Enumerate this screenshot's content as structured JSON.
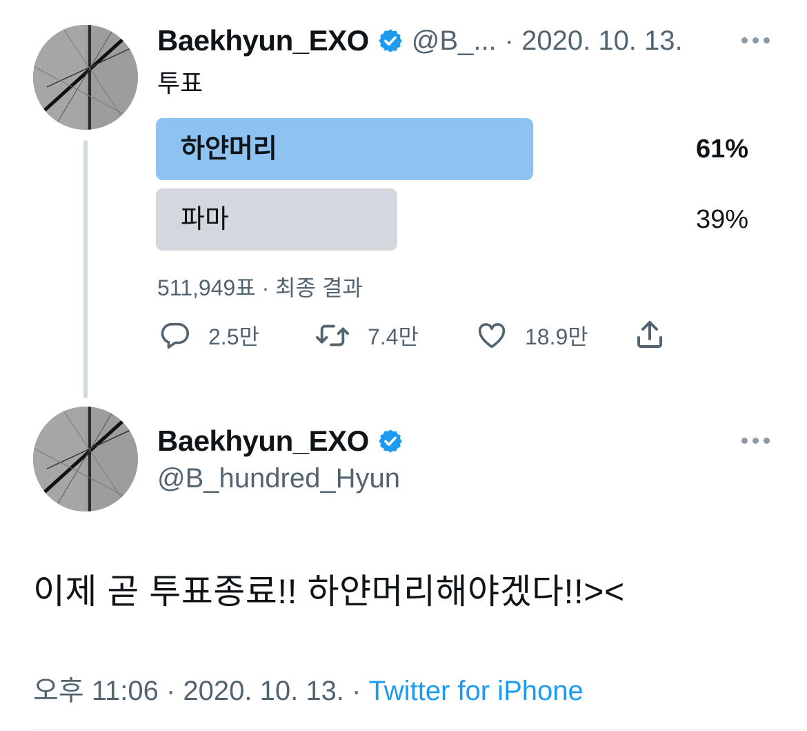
{
  "tweet1": {
    "name": "Baekhyun_EXO",
    "handle_trunc": "@B_...",
    "date": "· 2020. 10. 13.",
    "text": "투표",
    "poll": {
      "options": [
        {
          "label": "하얀머리",
          "percent": "61%",
          "value": 61,
          "leading": true
        },
        {
          "label": "파마",
          "percent": "39%",
          "value": 39,
          "leading": false
        }
      ],
      "votes": "511,949표 · 최종 결과"
    },
    "actions": {
      "reply": "2.5만",
      "retweet": "7.4만",
      "like": "18.9만"
    }
  },
  "tweet2": {
    "name": "Baekhyun_EXO",
    "handle": "@B_hundred_Hyun",
    "text": "이제 곧 투표종료!! 하얀머리해야겠다!!><",
    "time": "오후 11:06 · 2020. 10. 13. · ",
    "source": "Twitter for iPhone"
  },
  "colors": {
    "verified": "#1d9bf0",
    "poll_leading": "#8ec3f1",
    "poll_other": "#cfd9de",
    "link": "#1d9bf0",
    "muted": "#536471"
  },
  "icons": [
    "verified-badge-icon",
    "more-icon",
    "reply-icon",
    "retweet-icon",
    "like-icon",
    "share-icon"
  ]
}
